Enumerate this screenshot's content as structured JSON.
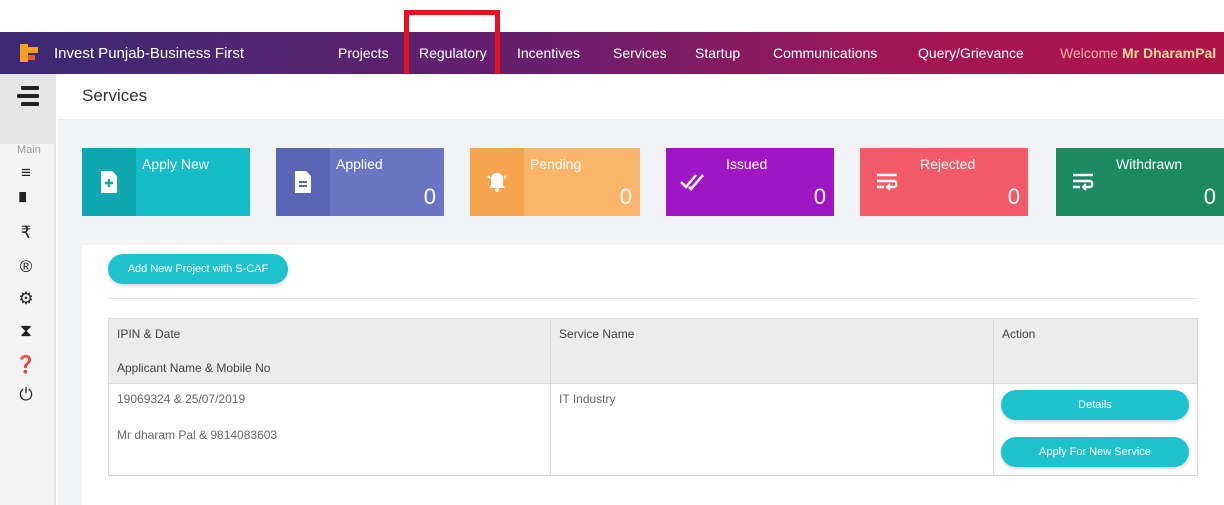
{
  "brand": {
    "title": "Invest Punjab-Business First"
  },
  "nav": {
    "items": [
      "Projects",
      "Regulatory",
      "Incentives",
      "Services",
      "Startup",
      "Communications",
      "Query/Grievance"
    ],
    "welcome_prefix": "Welcome ",
    "welcome_name": "Mr DharamPal"
  },
  "sidebar": {
    "label": "Main",
    "icons": [
      "list-icon",
      "file-icon",
      "rupee-icon",
      "registered-icon",
      "gears-icon",
      "hourglass-icon",
      "question-icon",
      "power-icon"
    ],
    "glyphs": [
      "≡",
      "▘",
      "₹",
      "®",
      "⚙",
      "⧗",
      "❓",
      "⏻"
    ]
  },
  "page": {
    "title": "Services"
  },
  "cards": [
    {
      "label": "Apply New",
      "count": "",
      "color": "#13bcc6",
      "icon": "plus-file-icon"
    },
    {
      "label": "Applied",
      "count": "0",
      "color": "#6a76c4",
      "icon": "file-icon"
    },
    {
      "label": "Pending",
      "count": "0",
      "color": "#fbb56a",
      "icon": "bell-icon"
    },
    {
      "label": "Issued",
      "count": "0",
      "color": "#a116c4",
      "icon": "double-check-icon"
    },
    {
      "label": "Rejected",
      "count": "0",
      "color": "#f35a67",
      "icon": "wrap-text-icon"
    },
    {
      "label": "Withdrawn",
      "count": "0",
      "color": "#1b8a62",
      "icon": "wrap-text-icon"
    }
  ],
  "actions": {
    "add_project": "Add New Project with S-CAF"
  },
  "table": {
    "headers": {
      "col1_line1": "IPIN & Date",
      "col1_line2": "Applicant Name & Mobile No",
      "col2": "Service Name",
      "col3": "Action"
    },
    "rows": [
      {
        "ipin_date": "19069324 & 25/07/2019",
        "applicant": "Mr dharam Pal & 9814083603",
        "service": "IT Industry",
        "details_label": "Details",
        "apply_label": "Apply For New Service"
      }
    ]
  }
}
